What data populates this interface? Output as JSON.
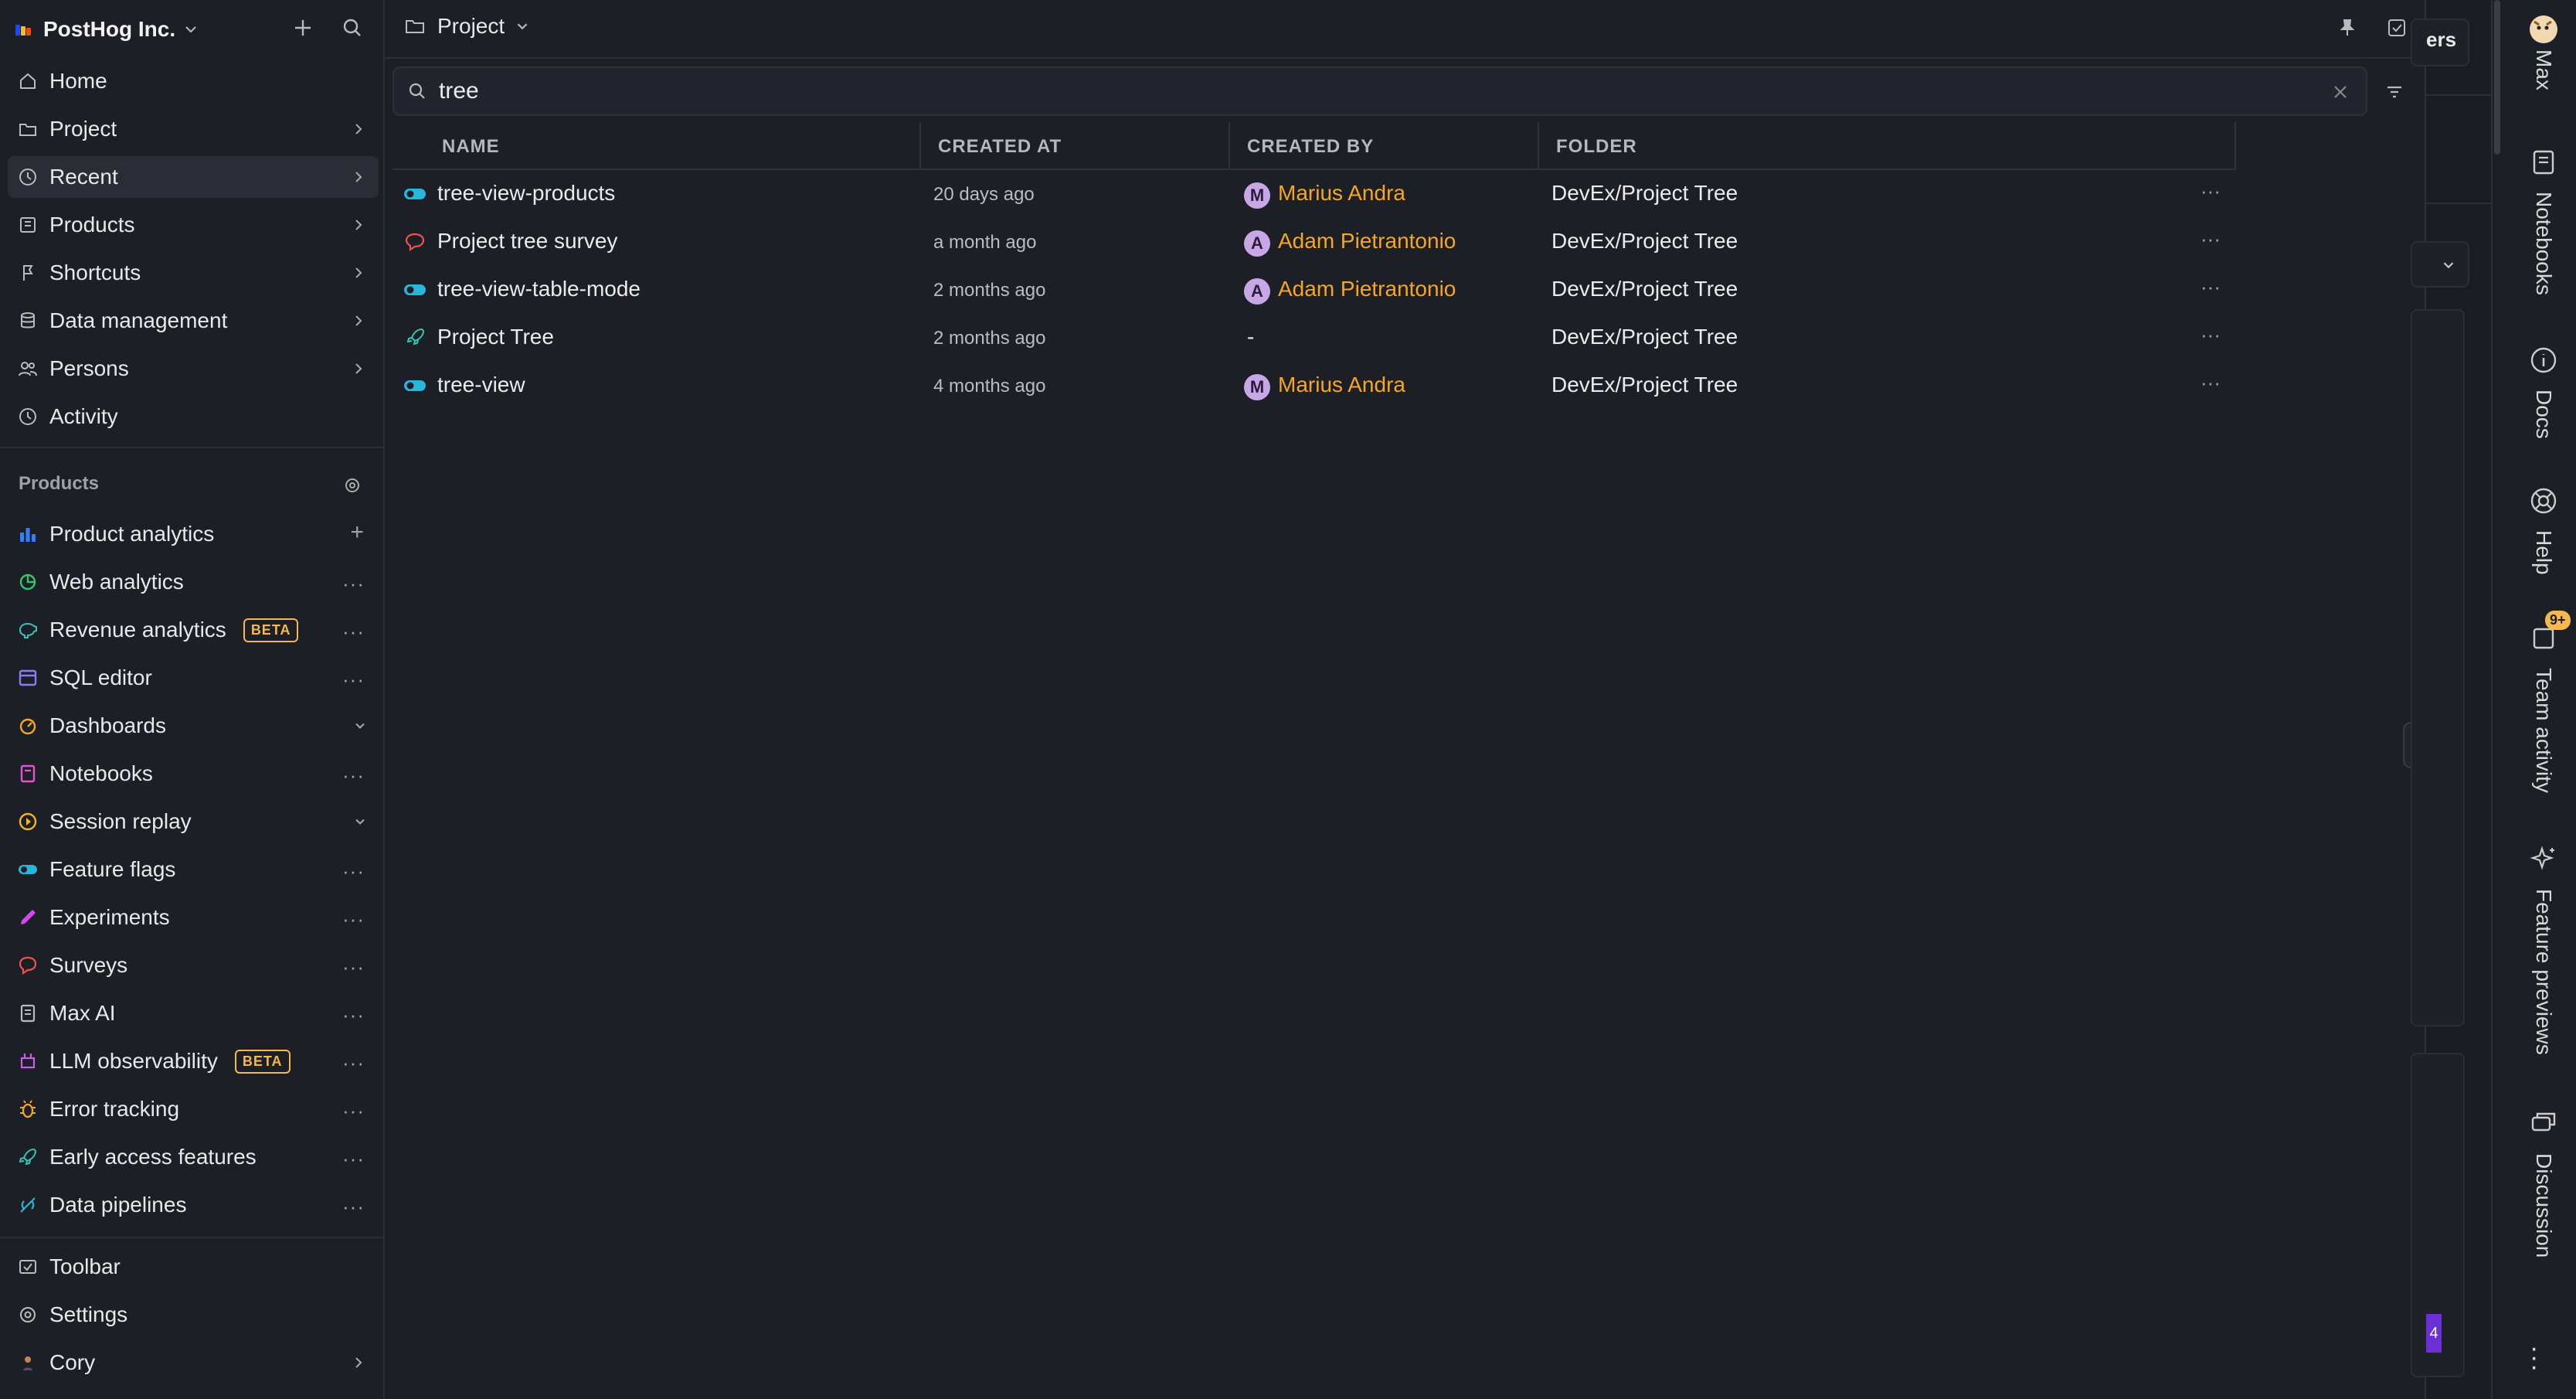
{
  "colors": {
    "accent": "#f5a623",
    "background": "#1d1f27",
    "beta": "#f5b84b"
  },
  "org": {
    "name": "PostHog Inc."
  },
  "nav": [
    {
      "label": "Home",
      "icon": "home-icon"
    },
    {
      "label": "Project",
      "icon": "folder-icon"
    },
    {
      "label": "Recent",
      "icon": "clock-icon"
    },
    {
      "label": "Products",
      "icon": "products-icon"
    },
    {
      "label": "Shortcuts",
      "icon": "shortcut-icon"
    },
    {
      "label": "Data management",
      "icon": "database-icon"
    },
    {
      "label": "Persons",
      "icon": "people-icon"
    },
    {
      "label": "Activity",
      "icon": "activity-icon"
    }
  ],
  "products_section": {
    "title": "Products"
  },
  "products": [
    {
      "label": "Product analytics",
      "icon": "bar-chart-icon"
    },
    {
      "label": "Web analytics",
      "icon": "web-analytics-icon"
    },
    {
      "label": "Revenue analytics",
      "icon": "revenue-icon",
      "badge": "BETA"
    },
    {
      "label": "SQL editor",
      "icon": "sql-icon"
    },
    {
      "label": "Dashboards",
      "icon": "dashboard-icon"
    },
    {
      "label": "Notebooks",
      "icon": "notebook-icon"
    },
    {
      "label": "Session replay",
      "icon": "replay-icon"
    },
    {
      "label": "Feature flags",
      "icon": "toggle-icon"
    },
    {
      "label": "Experiments",
      "icon": "flask-icon"
    },
    {
      "label": "Surveys",
      "icon": "survey-icon"
    },
    {
      "label": "Max AI",
      "icon": "max-ai-icon"
    },
    {
      "label": "LLM observability",
      "icon": "llm-icon",
      "badge": "BETA"
    },
    {
      "label": "Error tracking",
      "icon": "bug-icon"
    },
    {
      "label": "Early access features",
      "icon": "rocket-icon"
    },
    {
      "label": "Data pipelines",
      "icon": "pipeline-icon"
    }
  ],
  "footer": [
    {
      "label": "Toolbar",
      "icon": "toolbar-icon"
    },
    {
      "label": "Settings",
      "icon": "gear-icon"
    },
    {
      "label": "Cory",
      "icon": "user-icon"
    }
  ],
  "panel": {
    "breadcrumb": "Project",
    "search": {
      "value": "tree",
      "placeholder": ""
    },
    "columns": [
      "NAME",
      "CREATED AT",
      "CREATED BY",
      "FOLDER"
    ],
    "rows": [
      {
        "name": "tree-view-products",
        "icon": "toggle-icon",
        "created_at": "20 days ago",
        "created_by": "Marius Andra",
        "initial": "M",
        "folder": "DevEx/Project Tree"
      },
      {
        "name": "Project tree survey",
        "icon": "survey-icon",
        "created_at": "a month ago",
        "created_by": "Adam Pietrantonio",
        "initial": "A",
        "folder": "DevEx/Project Tree"
      },
      {
        "name": "tree-view-table-mode",
        "icon": "toggle-icon",
        "created_at": "2 months ago",
        "created_by": "Adam Pietrantonio",
        "initial": "A",
        "folder": "DevEx/Project Tree"
      },
      {
        "name": "Project Tree",
        "icon": "rocket-icon",
        "created_at": "2 months ago",
        "created_by": "-",
        "initial": "",
        "folder": "DevEx/Project Tree"
      },
      {
        "name": "tree-view",
        "icon": "toggle-icon",
        "created_at": "4 months ago",
        "created_by": "Marius Andra",
        "initial": "M",
        "folder": "DevEx/Project Tree"
      }
    ]
  },
  "peek": {
    "button_text": "ers",
    "tab_num": "4"
  },
  "rail": [
    {
      "label": "Max",
      "icon": "max-hedgehog-icon"
    },
    {
      "label": "Notebooks",
      "icon": "notebook-icon"
    },
    {
      "label": "Docs",
      "icon": "info-icon"
    },
    {
      "label": "Help",
      "icon": "help-icon"
    },
    {
      "label": "Team activity",
      "icon": "inbox-icon",
      "badge": "9+"
    },
    {
      "label": "Feature previews",
      "icon": "sparkle-icon"
    },
    {
      "label": "Discussion",
      "icon": "chat-icon"
    }
  ]
}
